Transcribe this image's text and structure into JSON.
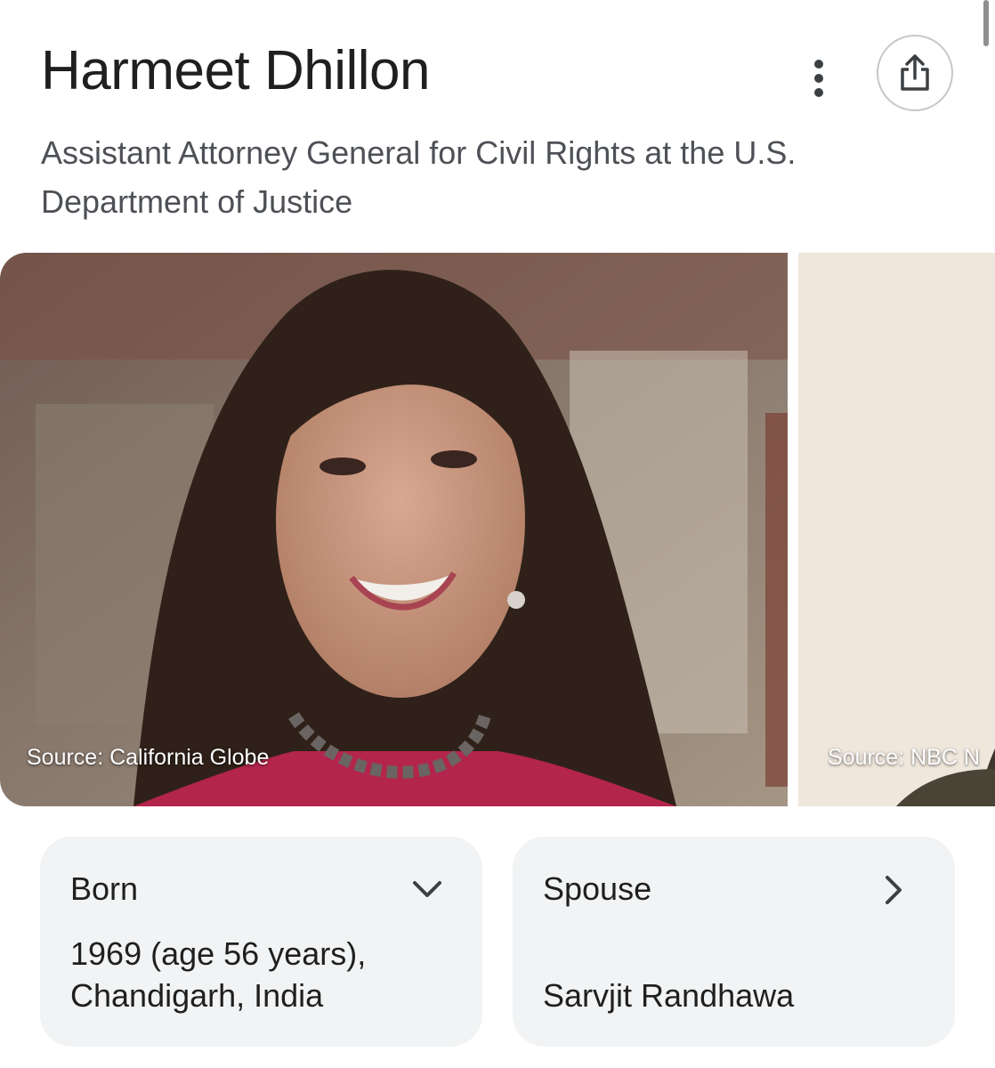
{
  "header": {
    "title": "Harmeet Dhillon",
    "subtitle": "Assistant Attorney General for Civil Rights at the U.S. Department of Justice",
    "more_icon": "more-vert-icon",
    "share_icon": "share-icon"
  },
  "images": [
    {
      "source": "Source: California Globe"
    },
    {
      "source": "Source: NBC N"
    }
  ],
  "facts": {
    "born": {
      "label": "Born",
      "value": "1969 (age 56 years), Chandigarh, India",
      "icon": "chevron-down-icon"
    },
    "spouse": {
      "label": "Spouse",
      "value": "Sarvjit Randhawa",
      "icon": "chevron-right-icon"
    }
  },
  "colors": {
    "card_bg": "#f1f3f4",
    "subtitle": "#4d5156",
    "title": "#1f1f1f"
  }
}
